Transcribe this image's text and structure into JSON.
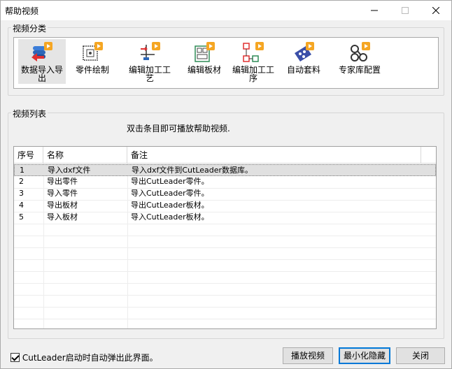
{
  "window": {
    "title": "帮助视频"
  },
  "category_group": {
    "label": "视频分类",
    "items": [
      {
        "label": "数据导入导出",
        "icon": "data-import-export-icon",
        "active": true
      },
      {
        "label": "零件绘制",
        "icon": "part-drawing-icon"
      },
      {
        "label": "编辑加工工艺",
        "icon": "edit-process-icon"
      },
      {
        "label": "编辑板材",
        "icon": "edit-sheet-icon"
      },
      {
        "label": "编辑加工工序",
        "icon": "edit-sequence-icon"
      },
      {
        "label": "自动套料",
        "icon": "auto-nesting-icon"
      },
      {
        "label": "专家库配置",
        "icon": "expert-library-icon"
      }
    ]
  },
  "list_group": {
    "label": "视频列表",
    "hint": "双击条目即可播放帮助视频.",
    "columns": [
      "序号",
      "名称",
      "备注"
    ],
    "rows": [
      {
        "no": "1",
        "name": "导入dxf文件",
        "note": "导入dxf文件到CutLeader数据库。"
      },
      {
        "no": "2",
        "name": "导出零件",
        "note": "导出CutLeader零件。"
      },
      {
        "no": "3",
        "name": "导入零件",
        "note": "导入CutLeader零件。"
      },
      {
        "no": "4",
        "name": "导出板材",
        "note": "导出CutLeader板材。"
      },
      {
        "no": "5",
        "name": "导入板材",
        "note": "导入CutLeader板材。"
      }
    ]
  },
  "footer": {
    "checkbox_label": "CutLeader启动时自动弹出此界面。",
    "checked": true,
    "play_button": "播放视频",
    "minimize_button": "最小化隐藏",
    "close_button": "关闭"
  },
  "colors": {
    "accent": "#0078d7",
    "icon_orange": "#f5a623"
  }
}
